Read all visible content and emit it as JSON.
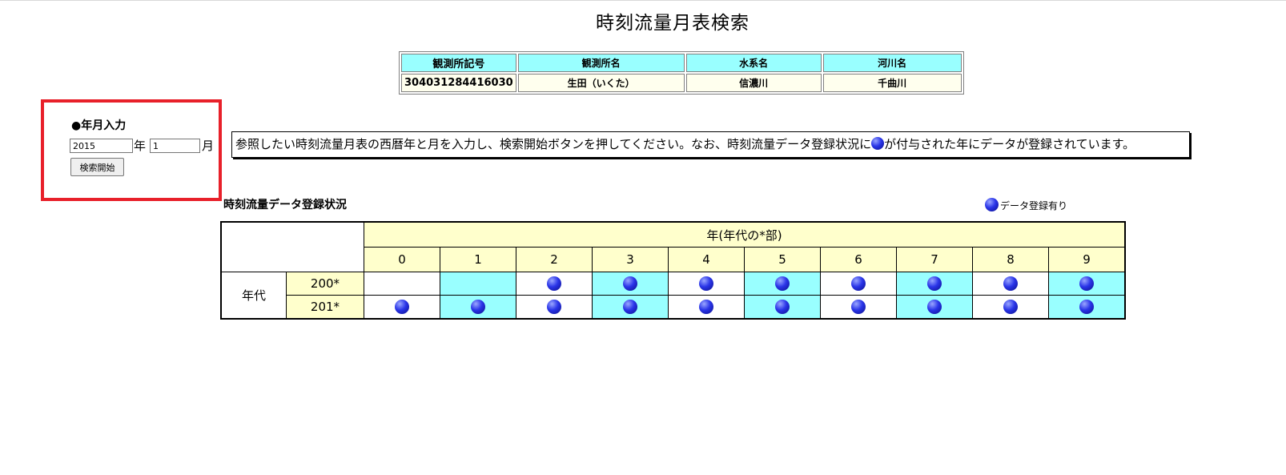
{
  "page": {
    "title": "時刻流量月表検索"
  },
  "station": {
    "headers": [
      "観測所記号",
      "観測所名",
      "水系名",
      "河川名"
    ],
    "values": [
      "304031284416030",
      "生田（いくた）",
      "信濃川",
      "千曲川"
    ]
  },
  "input": {
    "section_label": "●年月入力",
    "year_value": "2015",
    "year_unit": "年",
    "month_value": "1",
    "month_unit": "月",
    "search_button": "検索開始"
  },
  "instructions": {
    "before": "参照したい時刻流量月表の西暦年と月を入力し、検索開始ボタンを押してください。なお、時刻流量データ登録状況に",
    "after": "が付与された年にデータが登録されています。"
  },
  "status": {
    "title": "時刻流量データ登録状況",
    "legend": "データ登録有り",
    "year_header": "年(年代の*部)",
    "digits": [
      "0",
      "1",
      "2",
      "3",
      "4",
      "5",
      "6",
      "7",
      "8",
      "9"
    ],
    "decade_label": "年代",
    "decades": [
      "200*",
      "201*"
    ],
    "registered": [
      [
        false,
        false,
        true,
        true,
        true,
        true,
        true,
        true,
        true,
        true
      ],
      [
        true,
        true,
        true,
        true,
        true,
        true,
        true,
        true,
        true,
        true
      ]
    ]
  },
  "colors": {
    "accent_frame": "#e8202a",
    "cyan": "#99ffff",
    "cream": "#ffffcc",
    "ball": "#2a35e8"
  },
  "icons": {
    "registered_marker": "blue-ball-icon"
  }
}
